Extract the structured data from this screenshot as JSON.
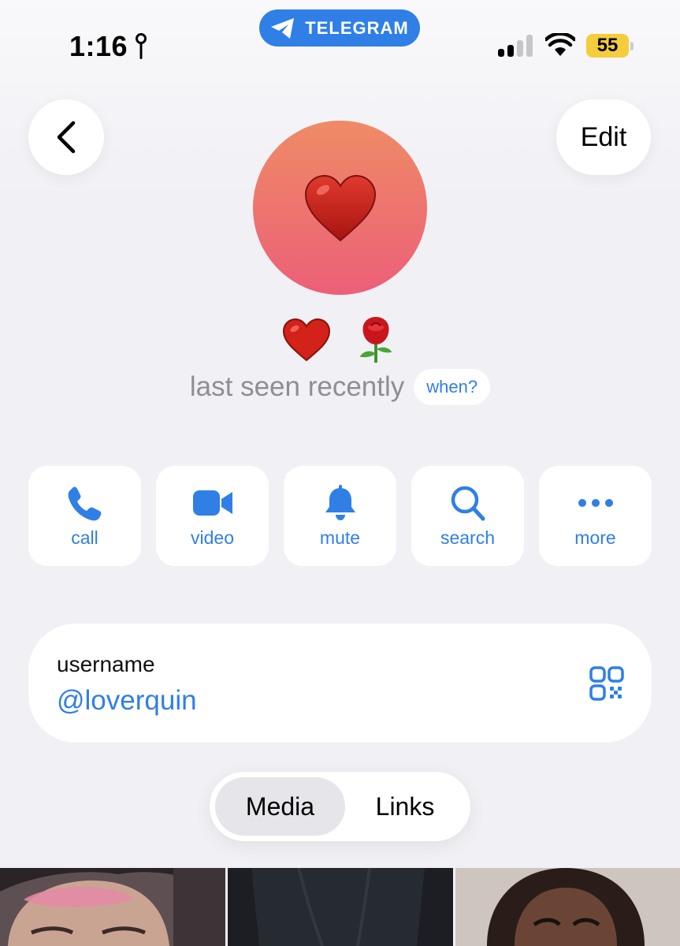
{
  "status_bar": {
    "time": "1:16",
    "pill_label": "TELEGRAM",
    "battery": "55",
    "signal_bars_active": 2,
    "signal_bars_total": 4
  },
  "header": {
    "back_icon": "chevron-left-icon",
    "edit_label": "Edit"
  },
  "profile": {
    "avatar_icon": "heart-icon",
    "avatar_gradient": [
      "#ef8b66",
      "#ec5f78"
    ],
    "name_icons": [
      "red-heart-icon",
      "rose-icon"
    ],
    "last_seen": "last seen recently",
    "when_label": "when?"
  },
  "actions": [
    {
      "label": "call",
      "icon": "phone-icon"
    },
    {
      "label": "video",
      "icon": "video-camera-icon"
    },
    {
      "label": "mute",
      "icon": "bell-icon"
    },
    {
      "label": "search",
      "icon": "search-icon"
    },
    {
      "label": "more",
      "icon": "ellipsis-icon"
    }
  ],
  "username_card": {
    "label": "username",
    "value": "@loverquin",
    "qr_icon": "qr-code-icon"
  },
  "tabs": [
    {
      "label": "Media",
      "active": true
    },
    {
      "label": "Links",
      "active": false
    }
  ],
  "colors": {
    "accent": "#2f7fe7",
    "background": "#f0f0f5",
    "battery": "#f5cc3c"
  }
}
